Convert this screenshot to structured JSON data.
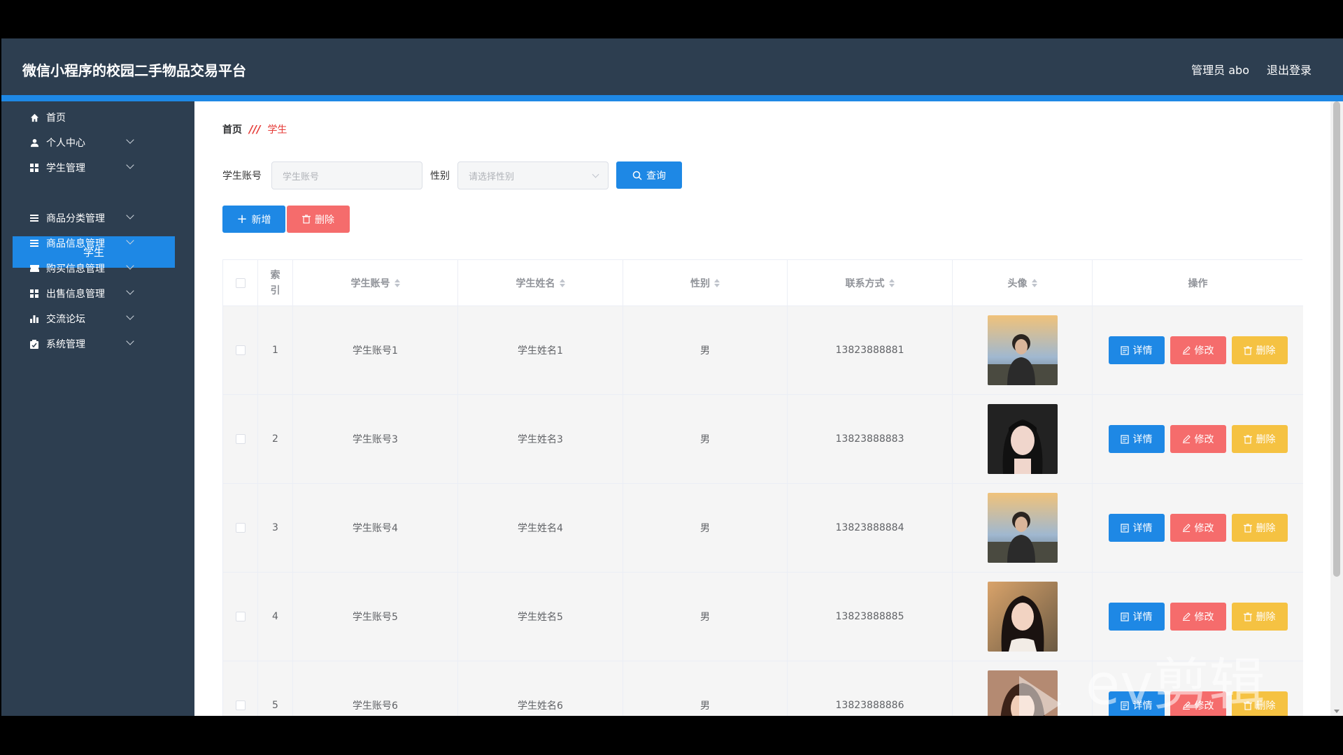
{
  "header": {
    "title": "微信小程序的校园二手物品交易平台",
    "user": "管理员 abo",
    "logout": "退出登录"
  },
  "sidebar": {
    "items": [
      {
        "label": "首页",
        "icon": "home-icon"
      },
      {
        "label": "个人中心",
        "icon": "user-icon"
      },
      {
        "label": "学生管理",
        "icon": "grid-icon"
      },
      {
        "label": "商品分类管理",
        "icon": "list-icon"
      },
      {
        "label": "商品信息管理",
        "icon": "list-icon"
      },
      {
        "label": "购买信息管理",
        "icon": "ticket-icon"
      },
      {
        "label": "出售信息管理",
        "icon": "grid-icon"
      },
      {
        "label": "交流论坛",
        "icon": "bar-chart-icon"
      },
      {
        "label": "系统管理",
        "icon": "clipboard-icon"
      }
    ],
    "active_sub": "学生"
  },
  "breadcrumb": {
    "home": "首页",
    "separator": "///",
    "current": "学生"
  },
  "search": {
    "account_label": "学生账号",
    "account_placeholder": "学生账号",
    "gender_label": "性别",
    "gender_placeholder": "请选择性别",
    "query_button": "查询"
  },
  "actions": {
    "add": "新增",
    "delete": "删除"
  },
  "table": {
    "headers": [
      "索引",
      "学生账号",
      "学生姓名",
      "性别",
      "联系方式",
      "头像",
      "操作"
    ],
    "rows": [
      {
        "index": "1",
        "account": "学生账号1",
        "name": "学生姓名1",
        "gender": "男",
        "phone": "13823888881",
        "avatar": "male"
      },
      {
        "index": "2",
        "account": "学生账号3",
        "name": "学生姓名3",
        "gender": "男",
        "phone": "13823888883",
        "avatar": "female"
      },
      {
        "index": "3",
        "account": "学生账号4",
        "name": "学生姓名4",
        "gender": "男",
        "phone": "13823888884",
        "avatar": "male"
      },
      {
        "index": "4",
        "account": "学生账号5",
        "name": "学生姓名5",
        "gender": "男",
        "phone": "13823888885",
        "avatar": "female2"
      },
      {
        "index": "5",
        "account": "学生账号6",
        "name": "学生姓名6",
        "gender": "男",
        "phone": "13823888886",
        "avatar": "female3"
      }
    ],
    "row_actions": {
      "detail": "详情",
      "edit": "修改",
      "delete": "删除"
    }
  },
  "watermark": "ev剪辑",
  "colors": {
    "header_bg": "#2d3e50",
    "accent": "#1e88e5",
    "danger": "#f56c6c",
    "warning": "#f5c242"
  }
}
